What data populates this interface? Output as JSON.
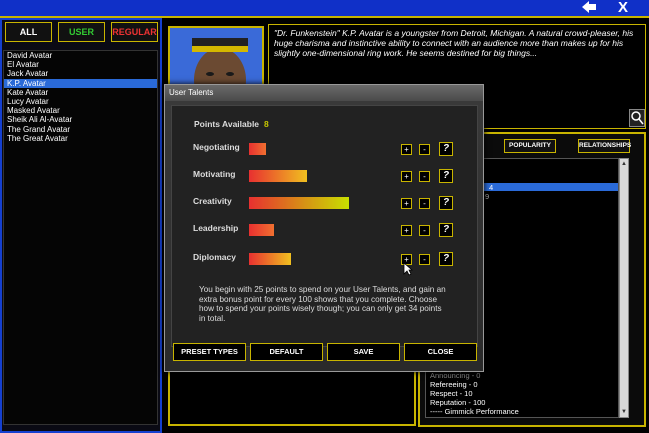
{
  "topbar": {
    "back_icon": "back-arrow-icon",
    "close_label": "X"
  },
  "filters": {
    "all": "ALL",
    "user": "USER",
    "regular": "REGULAR"
  },
  "wrestlers": [
    "David Avatar",
    "El Avatar",
    "Jack Avatar",
    "K.P. Avatar",
    "Kate Avatar",
    "Lucy Avatar",
    "Masked Avatar",
    "Sheik Ali Al-Avatar",
    "The Grand Avatar",
    "The Great Avatar"
  ],
  "selected_index": 3,
  "bio": "\"Dr. Funkenstein\" K.P. Avatar is a youngster from Detroit, Michigan. A natural crowd-pleaser, his huge charisma and instinctive ability to connect with an audience more than makes up for his slightly one-dimensional ring work. He seems destined for big things...",
  "tabs": {
    "popularity": "POPULARITY",
    "relationships": "RELATIONSHIPS"
  },
  "stats": {
    "announcing": "Announcing - 0",
    "refereeing": "Refereeing - 0",
    "respect": "Respect - 10",
    "reputation": "Reputation - 100",
    "gimmick": "----- Gimmick Performance",
    "partial_4": "4",
    "partial_9": "9"
  },
  "dialog": {
    "title": "User Talents",
    "points_label": "Points Available",
    "points_value": "8",
    "talents": [
      {
        "name": "Negotiating",
        "points": 2
      },
      {
        "name": "Motivating",
        "points": 7
      },
      {
        "name": "Creativity",
        "points": 12
      },
      {
        "name": "Leadership",
        "points": 3
      },
      {
        "name": "Diplomacy",
        "points": 5
      }
    ],
    "info": "You begin with 25 points to spend on your User Talents, and gain an extra bonus point for every 100 shows that you complete. Choose how to spend your points wisely though; you can only get 34 points in total.",
    "buttons": {
      "preset": "PRESET TYPES",
      "default": "DEFAULT",
      "save": "SAVE",
      "close": "CLOSE"
    },
    "plus": "+",
    "minus": "-",
    "help": "?"
  }
}
